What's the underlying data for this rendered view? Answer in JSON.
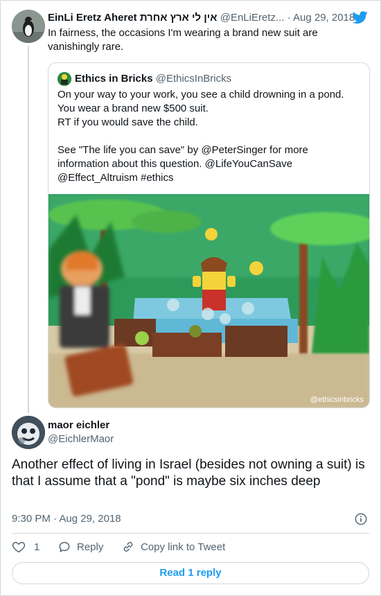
{
  "parent": {
    "display_name": "EinLi Eretz Aheret אין לי ארץ אחרת",
    "handle": "@EnLiEretz...",
    "separator": "·",
    "date": "Aug 29, 2018",
    "text": "In fairness, the occasions I'm wearing a brand new suit are vanishingly rare."
  },
  "quote": {
    "display_name": "Ethics in Bricks",
    "handle": "@EthicsInBricks",
    "lines": [
      "On your way to your work, you see a child drowning in a pond.",
      "You wear a brand new $500 suit.",
      "RT if you would save the child.",
      "",
      "See \"The life you can save\" by @PeterSinger for more information about this question. @LifeYouCanSave @Effect_Altruism #ethics"
    ],
    "watermark": "@ethicsinbricks"
  },
  "main": {
    "display_name": "maor eichler",
    "handle": "@EichlerMaor",
    "text": "Another effect of living in Israel (besides not owning a suit) is that I assume that a \"pond\" is maybe six inches deep",
    "time": "9:30 PM",
    "separator": "·",
    "date": "Aug 29, 2018"
  },
  "actions": {
    "like_count": "1",
    "reply_label": "Reply",
    "copy_label": "Copy link to Tweet"
  },
  "read_replies_label": "Read 1 reply",
  "icons": [
    "twitter-bird-icon",
    "info-icon",
    "heart-icon",
    "reply-icon",
    "link-icon"
  ],
  "colors": {
    "accent": "#1d9bf0",
    "secondary_text": "#536471",
    "border": "#cfd9de"
  }
}
